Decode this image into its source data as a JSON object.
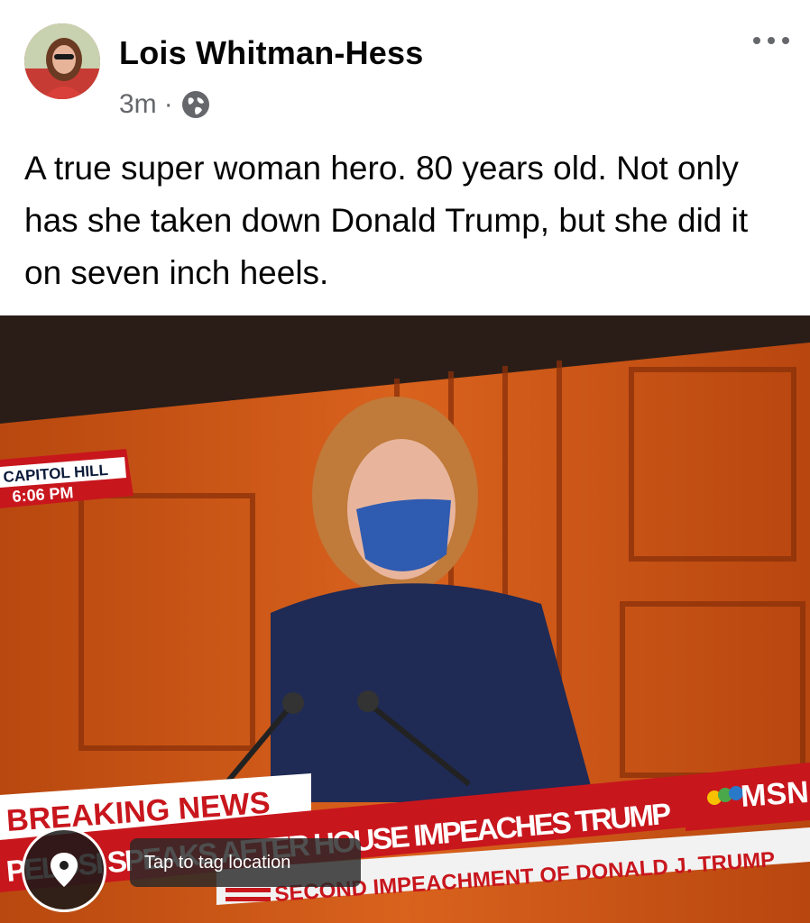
{
  "post": {
    "author": "Lois Whitman-Hess",
    "time": "3m",
    "separator": "·",
    "privacy_icon": "globe-icon",
    "more_icon": "more-options-icon",
    "text": "A true super woman hero. 80 years old. Not only has she taken down Donald Trump,  but she did it on seven inch heels."
  },
  "photo": {
    "location_label": "CAPITOL HILL",
    "time_label": "6:06 PM",
    "breaking_label": "BREAKING NEWS",
    "headline": "PELOSI SPEAKS AFTER HOUSE IMPEACHES TRUMP",
    "subheadline": "SECOND IMPEACHMENT OF DONALD J. TRUMP",
    "network": "MSN",
    "tag_location_label": "Tap to tag location",
    "location_icon": "map-pin-icon"
  },
  "colors": {
    "name": "#050505",
    "meta": "#65676b",
    "news_red": "#c8161d"
  }
}
